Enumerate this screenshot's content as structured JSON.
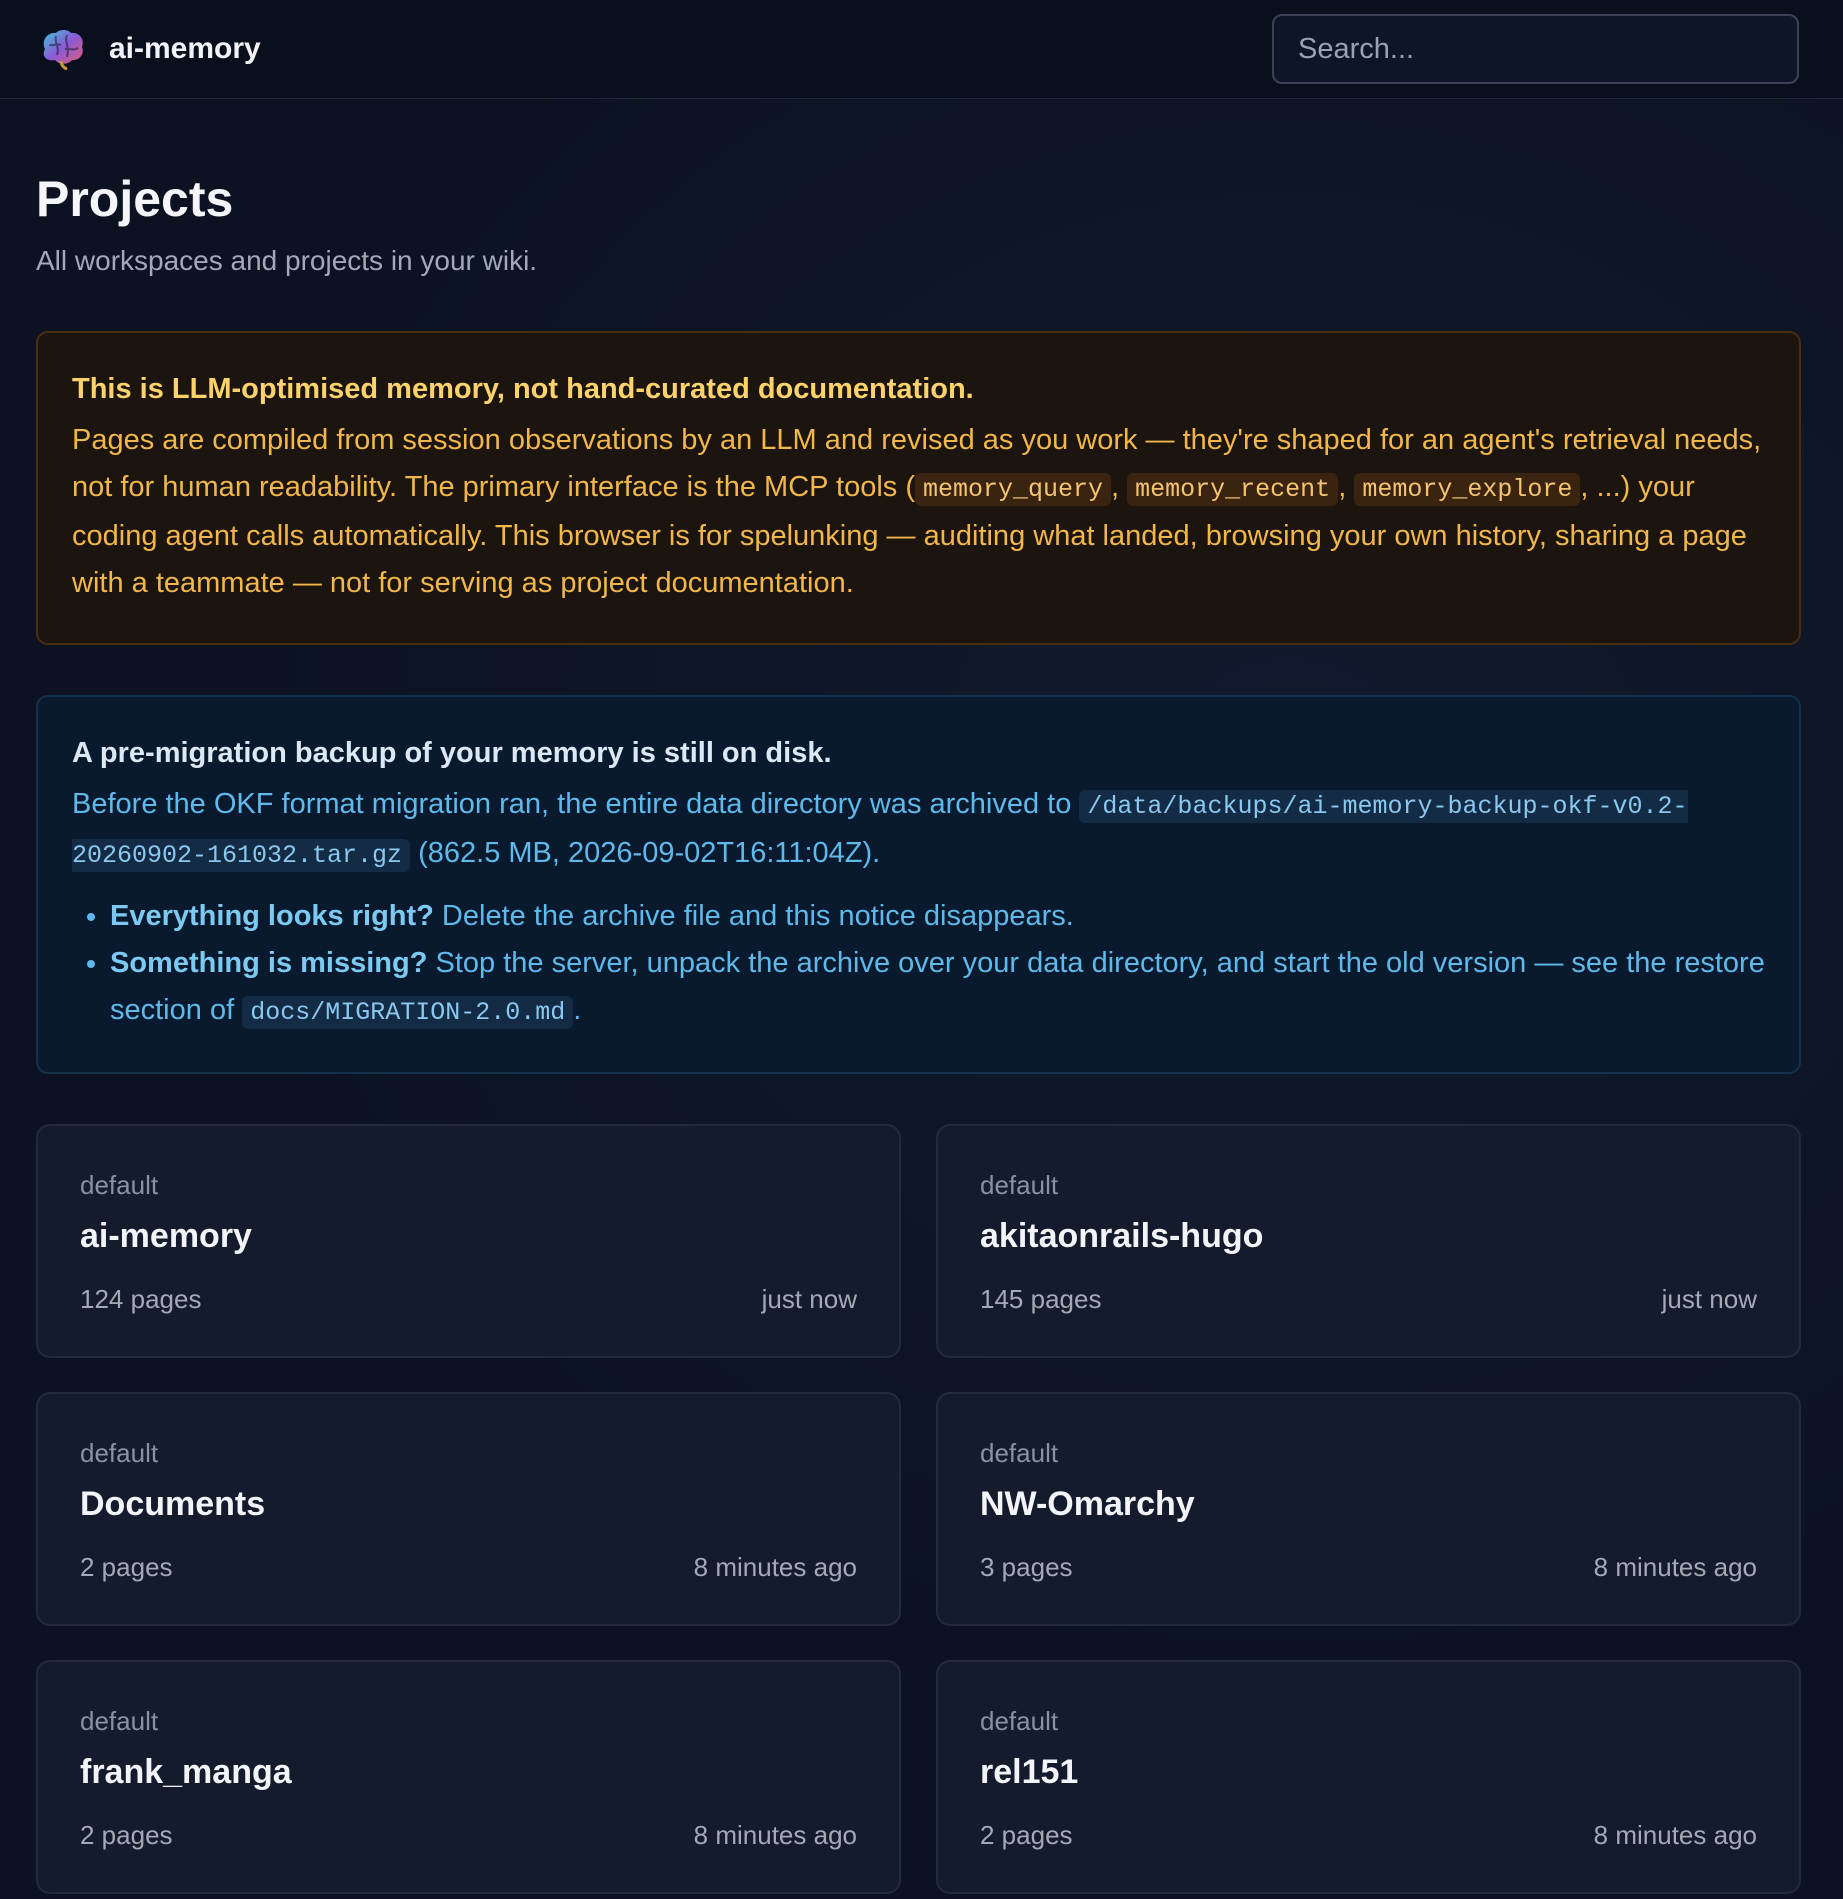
{
  "header": {
    "brand_name": "ai-memory",
    "logo_icon": "brain-icon",
    "search_placeholder": "Search..."
  },
  "page": {
    "title": "Projects",
    "subtitle": "All workspaces and projects in your wiki."
  },
  "llm_notice": {
    "title": "This is LLM-optimised memory, not hand-curated documentation.",
    "text_1": "Pages are compiled from session observations by an LLM and revised as you work — they're shaped for an agent's retrieval needs, not for human readability. The primary interface is the MCP tools (",
    "tool_1": "memory_query",
    "sep_1": ", ",
    "tool_2": "memory_recent",
    "sep_2": ", ",
    "tool_3": "memory_explore",
    "text_2": ", ...) your coding agent calls automatically. This browser is for spelunking — auditing what landed, browsing your own history, sharing a page with a teammate — not for serving as project documentation."
  },
  "backup_notice": {
    "title": "A pre-migration backup of your memory is still on disk.",
    "text_1": "Before the OKF format migration ran, the entire data directory was archived to ",
    "archive_path": "/data/backups/ai-memory-backup-okf-v0.2-20260902-161032.tar.gz",
    "text_2": " (862.5 MB, 2026-09-02T16:11:04Z).",
    "bullet_1_bold": "Everything looks right?",
    "bullet_1_text": " Delete the archive file and this notice disappears.",
    "bullet_2_bold": "Something is missing?",
    "bullet_2_text": " Stop the server, unpack the archive over your data directory, and start the old version — see the restore section of ",
    "bullet_2_code": "docs/MIGRATION-2.0.md",
    "bullet_2_end": "."
  },
  "projects": [
    {
      "workspace": "default",
      "name": "ai-memory",
      "pages": "124 pages",
      "updated": "just now"
    },
    {
      "workspace": "default",
      "name": "akitaonrails-hugo",
      "pages": "145 pages",
      "updated": "just now"
    },
    {
      "workspace": "default",
      "name": "Documents",
      "pages": "2 pages",
      "updated": "8 minutes ago"
    },
    {
      "workspace": "default",
      "name": "NW-Omarchy",
      "pages": "3 pages",
      "updated": "8 minutes ago"
    },
    {
      "workspace": "default",
      "name": "frank_manga",
      "pages": "2 pages",
      "updated": "8 minutes ago"
    },
    {
      "workspace": "default",
      "name": "rel151",
      "pages": "2 pages",
      "updated": "8 minutes ago"
    }
  ]
}
